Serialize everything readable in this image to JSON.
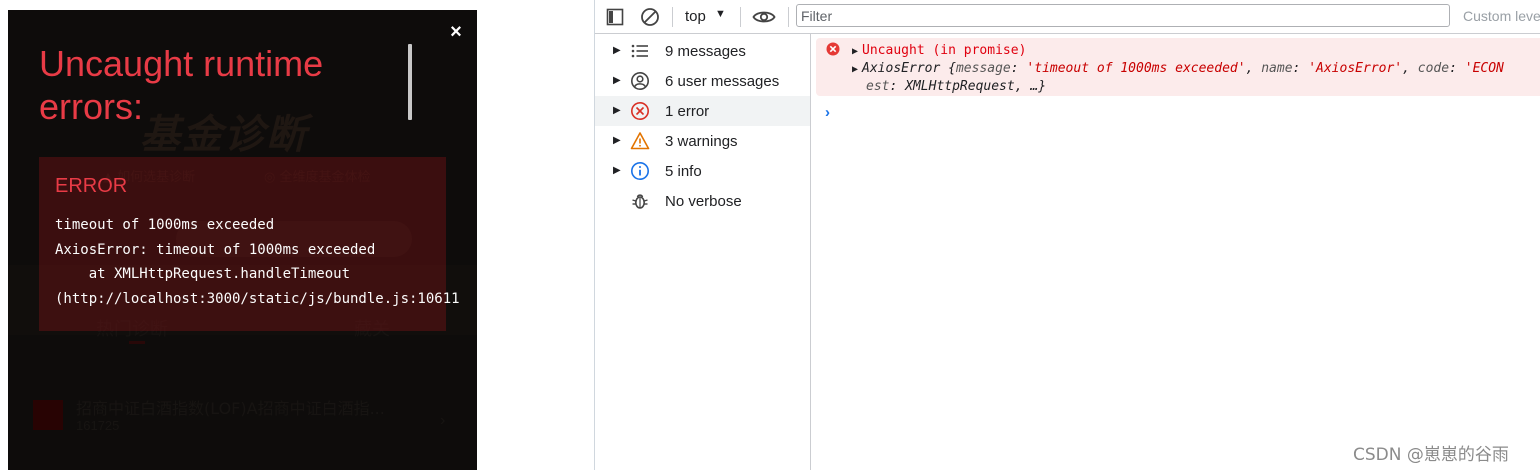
{
  "app_background": {
    "heading": "基金诊断",
    "subtitle_left": "▲ 如何选基诊断",
    "subtitle_right": "◎ 全维度基金体检",
    "tab_hot": "热门诊断",
    "tab_favorites": "藏关",
    "fund_name": "招商中证白酒指数(LOF)A招商中证白酒指...",
    "fund_code": "161725",
    "fund_chevron": "›"
  },
  "overlay": {
    "title": "Uncaught runtime errors:",
    "close_glyph": "×",
    "error_label": "ERROR",
    "error_message": "timeout of 1000ms exceeded\nAxiosError: timeout of 1000ms exceeded\n    at XMLHttpRequest.handleTimeout\n(http://localhost:3000/static/js/bundle.js:10611"
  },
  "devtools": {
    "toolbar": {
      "context": "top",
      "filter_placeholder": "Filter",
      "custom_levels": "Custom levels"
    },
    "sidebar": {
      "items": [
        {
          "label": "9 messages",
          "icon": "list-icon",
          "expandable": true
        },
        {
          "label": "6 user messages",
          "icon": "user-icon",
          "expandable": true
        },
        {
          "label": "1 error",
          "icon": "error-icon",
          "expandable": true,
          "selected": true
        },
        {
          "label": "3 warnings",
          "icon": "warning-icon",
          "expandable": true
        },
        {
          "label": "5 info",
          "icon": "info-icon",
          "expandable": true
        },
        {
          "label": "No verbose",
          "icon": "bug-icon",
          "expandable": false
        }
      ]
    },
    "console": {
      "error_title": "Uncaught (in promise)",
      "obj_class": "AxiosError",
      "obj_open": " {",
      "k_message": "message",
      "v_message": "'timeout of 1000ms exceeded'",
      "k_name": "name",
      "v_name": "'AxiosError'",
      "k_code": "code",
      "v_code": "'ECON",
      "line3_key": "est",
      "line3_val": "XMLHttpRequest",
      "line3_tail": ", …}",
      "colon": ": ",
      "comma": ", ",
      "prompt": "›"
    }
  },
  "watermark": "CSDN @崽崽的谷雨",
  "colors": {
    "error_red": "#e83b46",
    "console_error_text": "#e0000f",
    "console_error_bg": "#fcebeb",
    "link_blue": "#1a73e8"
  }
}
